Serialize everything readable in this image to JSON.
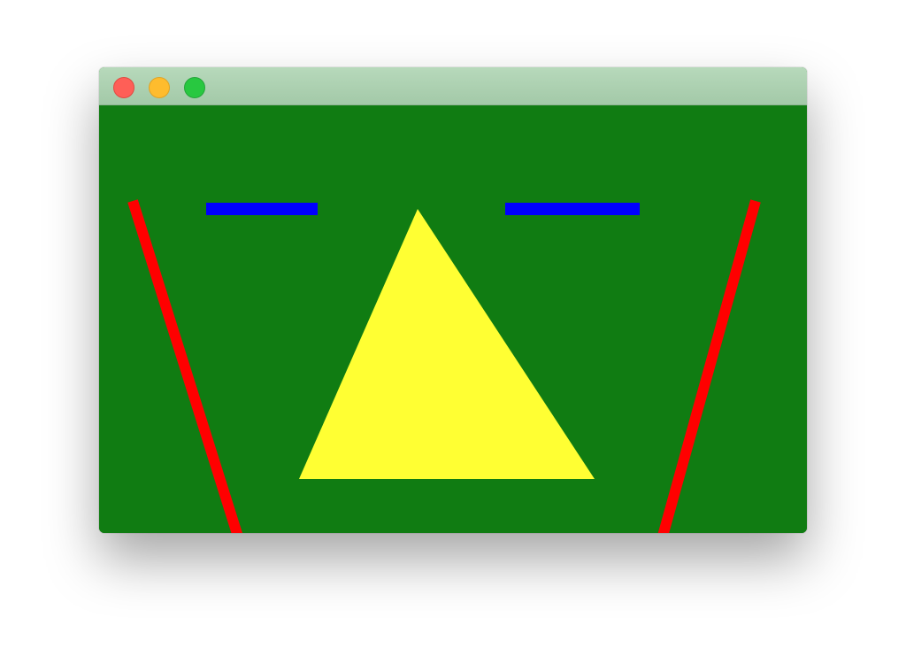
{
  "window": {
    "title": "",
    "traffic_lights": [
      {
        "name": "close",
        "color": "#fe5f57"
      },
      {
        "name": "minimize",
        "color": "#febc2e"
      },
      {
        "name": "zoom",
        "color": "#28c840"
      }
    ]
  },
  "canvas": {
    "background_color": "#107c12",
    "shapes": [
      {
        "name": "left-blue-bar",
        "kind": "bar",
        "color": "#0000ff"
      },
      {
        "name": "right-blue-bar",
        "kind": "bar",
        "color": "#0000ff"
      },
      {
        "name": "yellow-triangle",
        "kind": "triangle",
        "color": "#ffff33"
      },
      {
        "name": "red-trapezoid-outline",
        "kind": "polyline",
        "color": "#ff0000"
      }
    ]
  }
}
